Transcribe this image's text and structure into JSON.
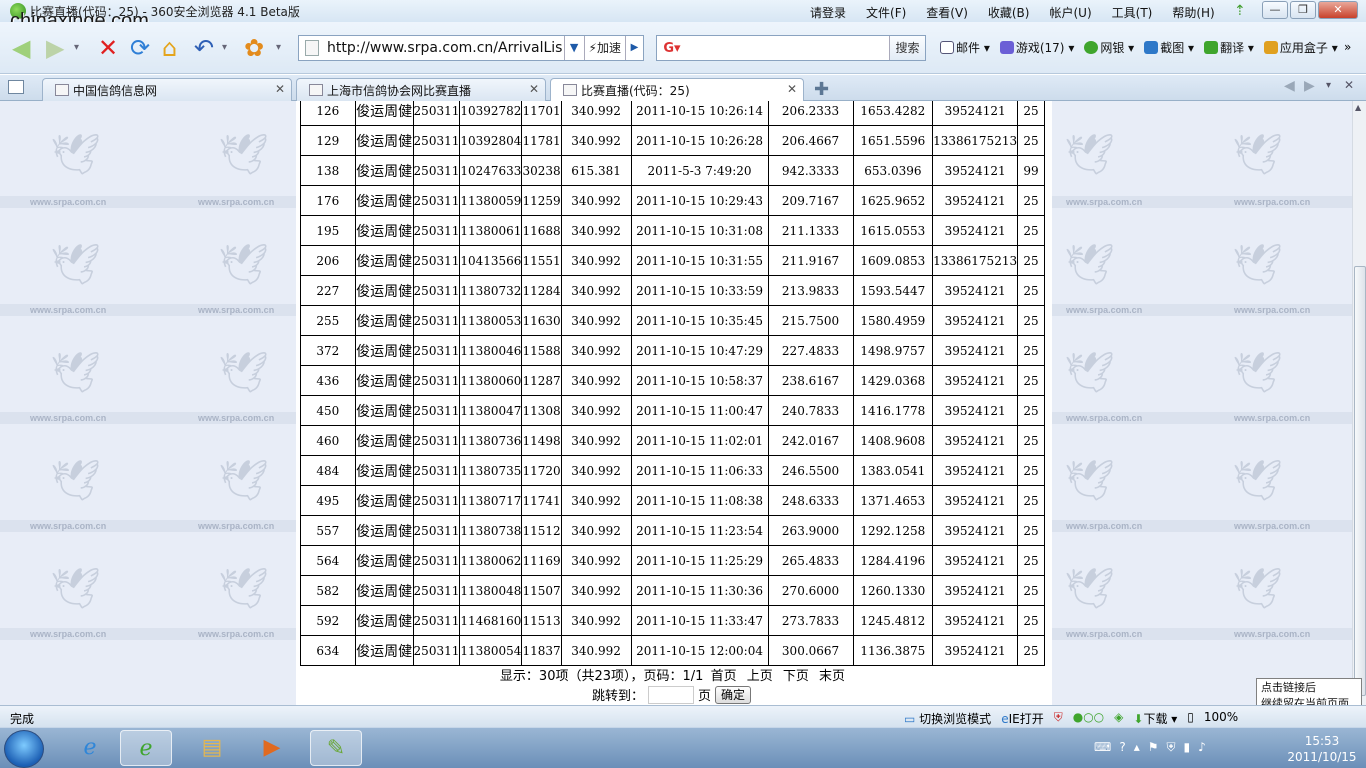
{
  "window": {
    "title": "比赛直播(代码：25) - 360安全浏览器 4.1 Beta版",
    "watermark": "chinaxinge.com",
    "menus": [
      "请登录",
      "文件(F)",
      "查看(V)",
      "收藏(B)",
      "帐户(U)",
      "工具(T)",
      "帮助(H)"
    ]
  },
  "toolbar": {
    "url": "http://www.srpa.com.cn/ArrivalLis",
    "speed_label": "加速",
    "search_button": "搜索",
    "tools": [
      "邮件",
      "游戏(17)",
      "网银",
      "截图",
      "翻译",
      "应用盒子"
    ]
  },
  "tabs": [
    {
      "label": "中国信鸽信息网"
    },
    {
      "label": "上海市信鸽协会网比赛直播"
    },
    {
      "label": "比赛直播(代码：25)"
    }
  ],
  "content": {
    "watermark_text": "www.srpa.com.cn",
    "rows": [
      [
        "126",
        "俊运周健",
        "250311",
        "10392782",
        "11701",
        "340.992",
        "2011-10-15 10:26:14",
        "206.2333",
        "1653.4282",
        "39524121",
        "25"
      ],
      [
        "129",
        "俊运周健",
        "250311",
        "10392804",
        "11781",
        "340.992",
        "2011-10-15 10:26:28",
        "206.4667",
        "1651.5596",
        "13386175213",
        "25"
      ],
      [
        "138",
        "俊运周健",
        "250311",
        "10247633",
        "30238",
        "615.381",
        "2011-5-3 7:49:20",
        "942.3333",
        "653.0396",
        "39524121",
        "99"
      ],
      [
        "176",
        "俊运周健",
        "250311",
        "11380059",
        "11259",
        "340.992",
        "2011-10-15 10:29:43",
        "209.7167",
        "1625.9652",
        "39524121",
        "25"
      ],
      [
        "195",
        "俊运周健",
        "250311",
        "11380061",
        "11688",
        "340.992",
        "2011-10-15 10:31:08",
        "211.1333",
        "1615.0553",
        "39524121",
        "25"
      ],
      [
        "206",
        "俊运周健",
        "250311",
        "10413566",
        "11551",
        "340.992",
        "2011-10-15 10:31:55",
        "211.9167",
        "1609.0853",
        "13386175213",
        "25"
      ],
      [
        "227",
        "俊运周健",
        "250311",
        "11380732",
        "11284",
        "340.992",
        "2011-10-15 10:33:59",
        "213.9833",
        "1593.5447",
        "39524121",
        "25"
      ],
      [
        "255",
        "俊运周健",
        "250311",
        "11380053",
        "11630",
        "340.992",
        "2011-10-15 10:35:45",
        "215.7500",
        "1580.4959",
        "39524121",
        "25"
      ],
      [
        "372",
        "俊运周健",
        "250311",
        "11380046",
        "11588",
        "340.992",
        "2011-10-15 10:47:29",
        "227.4833",
        "1498.9757",
        "39524121",
        "25"
      ],
      [
        "436",
        "俊运周健",
        "250311",
        "11380060",
        "11287",
        "340.992",
        "2011-10-15 10:58:37",
        "238.6167",
        "1429.0368",
        "39524121",
        "25"
      ],
      [
        "450",
        "俊运周健",
        "250311",
        "11380047",
        "11308",
        "340.992",
        "2011-10-15 11:00:47",
        "240.7833",
        "1416.1778",
        "39524121",
        "25"
      ],
      [
        "460",
        "俊运周健",
        "250311",
        "11380736",
        "11498",
        "340.992",
        "2011-10-15 11:02:01",
        "242.0167",
        "1408.9608",
        "39524121",
        "25"
      ],
      [
        "484",
        "俊运周健",
        "250311",
        "11380735",
        "11720",
        "340.992",
        "2011-10-15 11:06:33",
        "246.5500",
        "1383.0541",
        "39524121",
        "25"
      ],
      [
        "495",
        "俊运周健",
        "250311",
        "11380717",
        "11741",
        "340.992",
        "2011-10-15 11:08:38",
        "248.6333",
        "1371.4653",
        "39524121",
        "25"
      ],
      [
        "557",
        "俊运周健",
        "250311",
        "11380738",
        "11512",
        "340.992",
        "2011-10-15 11:23:54",
        "263.9000",
        "1292.1258",
        "39524121",
        "25"
      ],
      [
        "564",
        "俊运周健",
        "250311",
        "11380062",
        "11169",
        "340.992",
        "2011-10-15 11:25:29",
        "265.4833",
        "1284.4196",
        "39524121",
        "25"
      ],
      [
        "582",
        "俊运周健",
        "250311",
        "11380048",
        "11507",
        "340.992",
        "2011-10-15 11:30:36",
        "270.6000",
        "1260.1330",
        "39524121",
        "25"
      ],
      [
        "592",
        "俊运周健",
        "250311",
        "11468160",
        "11513",
        "340.992",
        "2011-10-15 11:33:47",
        "273.7833",
        "1245.4812",
        "39524121",
        "25"
      ],
      [
        "634",
        "俊运周健",
        "250311",
        "11380054",
        "11837",
        "340.992",
        "2011-10-15 12:00:04",
        "300.0667",
        "1136.3875",
        "39524121",
        "25"
      ]
    ],
    "pager": {
      "summary": "显示：30项（共23项），页码：1/1",
      "first": "首页",
      "prev": "上页",
      "next": "下页",
      "last": "末页",
      "jump_label": "跳转到：",
      "page_unit": "页",
      "confirm": "确定"
    }
  },
  "tooltip": {
    "line1": "点击链接后",
    "line2": "继续留在当前页面"
  },
  "statusbar": {
    "status": "完成",
    "switch_mode": "切换浏览模式",
    "ie_open": "IE打开",
    "download": "下载",
    "zoom": "100%"
  },
  "taskbar": {
    "time": "15:53",
    "date": "2011/10/15"
  },
  "colors": {
    "content_bg": "#e8edf7",
    "panel_bg": "#ffffff",
    "border": "#000000"
  }
}
